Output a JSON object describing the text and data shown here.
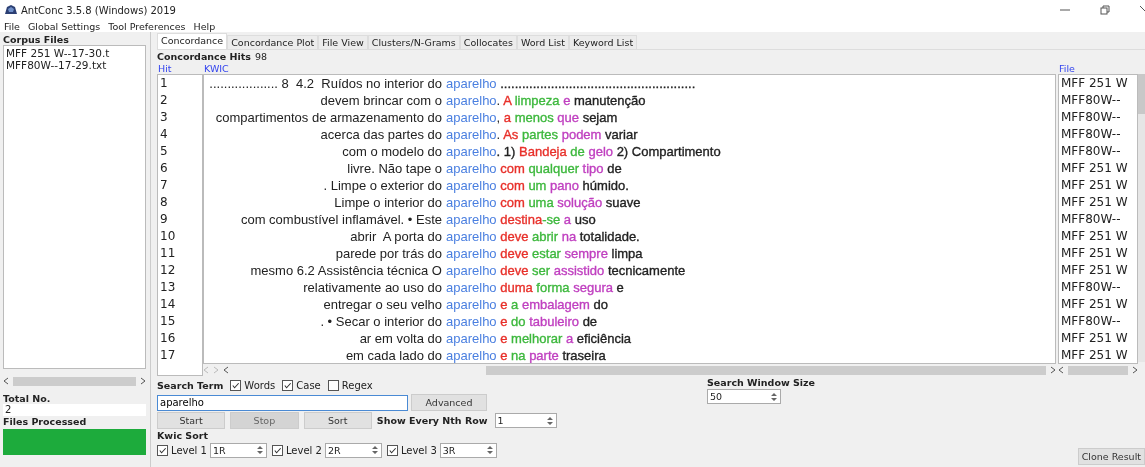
{
  "window": {
    "title": "AntConc 3.5.8 (Windows) 2019"
  },
  "menu": [
    "File",
    "Global Settings",
    "Tool Preferences",
    "Help"
  ],
  "sidebar": {
    "corpus_label": "Corpus Files",
    "files": [
      "MFF 251 W--17-30.t",
      "MFF80W--17-29.txt"
    ],
    "total_label": "Total No.",
    "total": "2",
    "processed_label": "Files Processed",
    "processed": {
      "level": 1
    }
  },
  "tabs": [
    {
      "label": "Concordance",
      "selected": true
    },
    {
      "label": "Concordance Plot",
      "selected": false
    },
    {
      "label": "File View",
      "selected": false
    },
    {
      "label": "Clusters/N-Grams",
      "selected": false
    },
    {
      "label": "Collocates",
      "selected": false
    },
    {
      "label": "Word List",
      "selected": false
    },
    {
      "label": "Keyword List",
      "selected": false
    }
  ],
  "hits_label": "Concordance Hits",
  "hits": "98",
  "columns": {
    "hit": "Hit",
    "kwic": "KWIC",
    "file": "File"
  },
  "rows": [
    {
      "hit": "1",
      "left": "................... 8  4.2  Ruídos no interior do",
      "key": "aparelho",
      "right": [
        {
          "text": " ......................................................",
          "color": "#222222"
        }
      ],
      "file": "MFF 251 W"
    },
    {
      "hit": "2",
      "left": "devem brincar com o",
      "key": "aparelho",
      "punct": ".",
      "right": [
        {
          "text": " A",
          "color": "#e8302a"
        },
        {
          "text": " limpeza",
          "color": "#3db83d"
        },
        {
          "text": " e",
          "color": "#c040c0"
        },
        {
          "text": " manutenção",
          "color": "#222222"
        }
      ],
      "file": "MFF80W--"
    },
    {
      "hit": "3",
      "left": "compartimentos de armazenamento do",
      "key": "aparelho",
      "punct": ",",
      "right": [
        {
          "text": " a",
          "color": "#e8302a"
        },
        {
          "text": " menos",
          "color": "#3db83d"
        },
        {
          "text": " que",
          "color": "#c040c0"
        },
        {
          "text": " sejam",
          "color": "#222222"
        }
      ],
      "file": "MFF80W--"
    },
    {
      "hit": "4",
      "left": "acerca das partes do",
      "key": "aparelho",
      "punct": ".",
      "right": [
        {
          "text": " As",
          "color": "#e8302a"
        },
        {
          "text": " partes",
          "color": "#3db83d"
        },
        {
          "text": " podem",
          "color": "#c040c0"
        },
        {
          "text": " variar",
          "color": "#222222"
        }
      ],
      "file": "MFF80W--"
    },
    {
      "hit": "5",
      "left": "com o modelo do",
      "key": "aparelho",
      "right": [
        {
          "text": ". 1)",
          "color": "#222222"
        },
        {
          "text": " Bandeja",
          "color": "#e8302a"
        },
        {
          "text": " de",
          "color": "#3db83d"
        },
        {
          "text": " gelo",
          "color": "#c040c0"
        },
        {
          "text": " 2) Compartimento",
          "color": "#222222"
        }
      ],
      "file": "MFF80W--"
    },
    {
      "hit": "6",
      "left": "livre. Não tape o",
      "key": "aparelho",
      "right": [
        {
          "text": " com",
          "color": "#e8302a"
        },
        {
          "text": " qualquer",
          "color": "#3db83d"
        },
        {
          "text": " tipo",
          "color": "#c040c0"
        },
        {
          "text": " de",
          "color": "#222222"
        }
      ],
      "file": "MFF 251 W"
    },
    {
      "hit": "7",
      "left": ". Limpe o exterior do",
      "key": "aparelho",
      "right": [
        {
          "text": " com",
          "color": "#e8302a"
        },
        {
          "text": " um",
          "color": "#3db83d"
        },
        {
          "text": " pano",
          "color": "#c040c0"
        },
        {
          "text": " húmido.",
          "color": "#222222"
        }
      ],
      "file": "MFF 251 W"
    },
    {
      "hit": "8",
      "left": "Limpe o interior do",
      "key": "aparelho",
      "right": [
        {
          "text": " com",
          "color": "#e8302a"
        },
        {
          "text": " uma",
          "color": "#3db83d"
        },
        {
          "text": " solução",
          "color": "#c040c0"
        },
        {
          "text": " suave",
          "color": "#222222"
        }
      ],
      "file": "MFF 251 W"
    },
    {
      "hit": "9",
      "left": "com combustível inflamável. • Este",
      "key": "aparelho",
      "right": [
        {
          "text": " destina",
          "color": "#e8302a"
        },
        {
          "text": "-se",
          "color": "#3db83d"
        },
        {
          "text": " a",
          "color": "#c040c0"
        },
        {
          "text": " uso",
          "color": "#222222"
        }
      ],
      "file": "MFF80W--"
    },
    {
      "hit": "10",
      "left": "abrir  A porta do",
      "key": "aparelho",
      "right": [
        {
          "text": " deve",
          "color": "#e8302a"
        },
        {
          "text": " abrir",
          "color": "#3db83d"
        },
        {
          "text": " na",
          "color": "#c040c0"
        },
        {
          "text": " totalidade.",
          "color": "#222222"
        }
      ],
      "file": "MFF 251 W"
    },
    {
      "hit": "11",
      "left": "parede por trás do",
      "key": "aparelho",
      "right": [
        {
          "text": " deve",
          "color": "#e8302a"
        },
        {
          "text": " estar",
          "color": "#3db83d"
        },
        {
          "text": " sempre",
          "color": "#c040c0"
        },
        {
          "text": " limpa",
          "color": "#222222"
        }
      ],
      "file": "MFF 251 W"
    },
    {
      "hit": "12",
      "left": "mesmo 6.2 Assistência técnica O",
      "key": "aparelho",
      "right": [
        {
          "text": " deve",
          "color": "#e8302a"
        },
        {
          "text": " ser",
          "color": "#3db83d"
        },
        {
          "text": " assistido",
          "color": "#c040c0"
        },
        {
          "text": " tecnicamente",
          "color": "#222222"
        }
      ],
      "file": "MFF 251 W"
    },
    {
      "hit": "13",
      "left": "relativamente ao uso do",
      "key": "aparelho",
      "right": [
        {
          "text": " duma",
          "color": "#e8302a"
        },
        {
          "text": " forma",
          "color": "#3db83d"
        },
        {
          "text": " segura",
          "color": "#c040c0"
        },
        {
          "text": " e",
          "color": "#222222"
        }
      ],
      "file": "MFF80W--"
    },
    {
      "hit": "14",
      "left": "entregar o seu velho",
      "key": "aparelho",
      "right": [
        {
          "text": " e",
          "color": "#e8302a"
        },
        {
          "text": " a",
          "color": "#3db83d"
        },
        {
          "text": " embalagem",
          "color": "#c040c0"
        },
        {
          "text": " do",
          "color": "#222222"
        }
      ],
      "file": "MFF 251 W"
    },
    {
      "hit": "15",
      "left": ". • Secar o interior do",
      "key": "aparelho",
      "right": [
        {
          "text": " e",
          "color": "#e8302a"
        },
        {
          "text": " do",
          "color": "#3db83d"
        },
        {
          "text": " tabuleiro",
          "color": "#c040c0"
        },
        {
          "text": " de",
          "color": "#222222"
        }
      ],
      "file": "MFF80W--"
    },
    {
      "hit": "16",
      "left": "ar em volta do",
      "key": "aparelho",
      "right": [
        {
          "text": " e",
          "color": "#e8302a"
        },
        {
          "text": " melhorar",
          "color": "#3db83d"
        },
        {
          "text": " a",
          "color": "#c040c0"
        },
        {
          "text": " eficiência",
          "color": "#222222"
        }
      ],
      "file": "MFF 251 W"
    },
    {
      "hit": "17",
      "left": "em cada lado do",
      "key": "aparelho",
      "right": [
        {
          "text": " e",
          "color": "#e8302a"
        },
        {
          "text": " na",
          "color": "#3db83d"
        },
        {
          "text": " parte",
          "color": "#c040c0"
        },
        {
          "text": " traseira",
          "color": "#222222"
        }
      ],
      "file": "MFF 251 W"
    }
  ],
  "search": {
    "label": "Search Term",
    "options": [
      {
        "label": "Words",
        "checked": true
      },
      {
        "label": "Case",
        "checked": true
      },
      {
        "label": "Regex",
        "checked": false
      }
    ],
    "value": "aparelho",
    "advanced": "Advanced",
    "window_label": "Search Window Size",
    "window_size": "50"
  },
  "buttons": [
    {
      "label": "Start",
      "disabled": false
    },
    {
      "label": "Stop",
      "disabled": true
    },
    {
      "label": "Sort",
      "disabled": false
    }
  ],
  "nth": {
    "label": "Show Every Nth Row",
    "value": "1"
  },
  "kwic_sort": {
    "label": "Kwic Sort",
    "levels": [
      {
        "label": "Level 1",
        "checked": true,
        "value": "1R"
      },
      {
        "label": "Level 2",
        "checked": true,
        "value": "2R"
      },
      {
        "label": "Level 3",
        "checked": true,
        "value": "3R"
      }
    ]
  },
  "clone": "Clone Result"
}
